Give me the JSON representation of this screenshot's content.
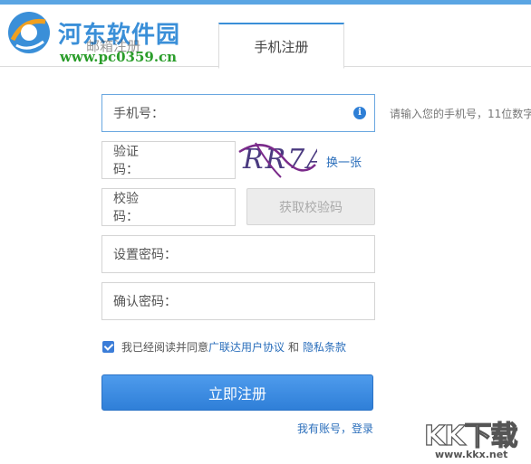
{
  "watermark": {
    "site_name": "河东软件园",
    "site_url": "www.pc0359.cn",
    "corner_brand": "KK下载",
    "corner_url": "www.kkx.net"
  },
  "tabs": [
    {
      "label": "邮箱注册",
      "active": false
    },
    {
      "label": "手机注册",
      "active": true
    }
  ],
  "form": {
    "phone_label": "手机号：",
    "phone_hint": "请输入您的手机号，11位数字",
    "captcha_label": "验证码：",
    "captcha_text": "RR7A",
    "refresh_label": "换一张",
    "verify_label": "校验码：",
    "get_code_label": "获取校验码",
    "password_label": "设置密码：",
    "confirm_label": "确认密码：",
    "agree_text": "我已经阅读并同意",
    "agreement_link": "广联达用户协议",
    "and_text": "和",
    "privacy_link": "隐私条款",
    "agree_checked": true,
    "submit_label": "立即注册",
    "login_link": "我有账号，登录"
  },
  "colors": {
    "accent": "#3a8fd8",
    "link": "#2a6ebb",
    "button": "#2f7fd8"
  }
}
